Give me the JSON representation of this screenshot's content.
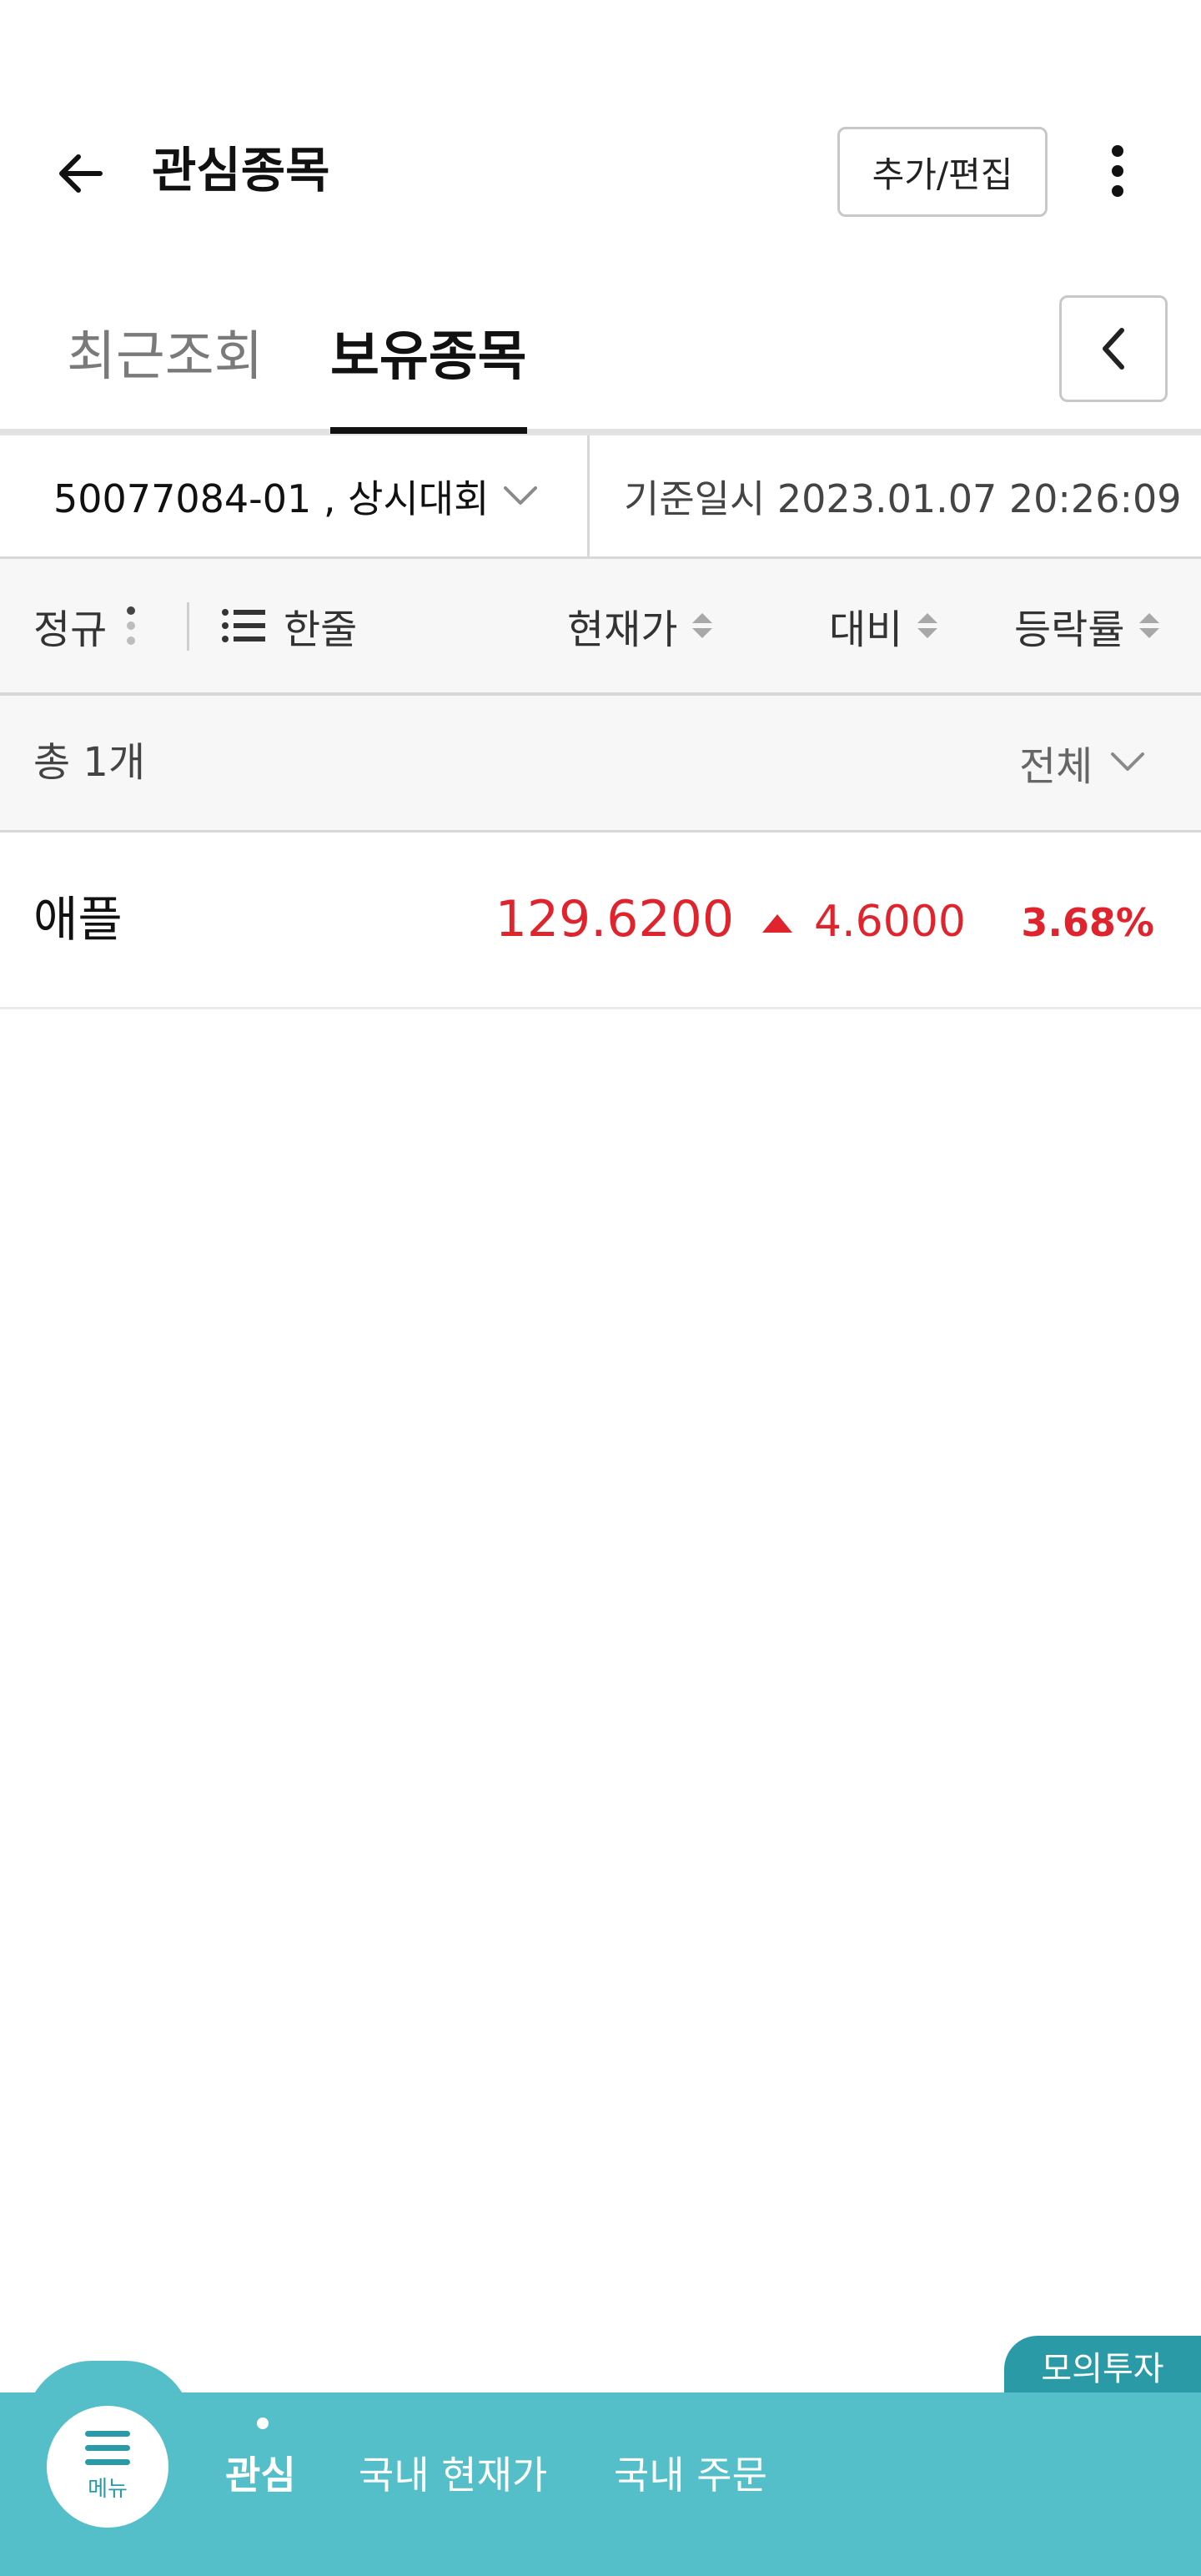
{
  "header": {
    "title": "관심종목",
    "add_edit_label": "추가/편집",
    "back_icon": "arrow-left-icon",
    "more_icon": "kebab-menu-icon"
  },
  "tabs": [
    {
      "label": "최근조회",
      "active": false
    },
    {
      "label": "보유종목",
      "active": true
    }
  ],
  "account": {
    "label": "50077084-01 , 상시대회",
    "base_time": "기준일시 2023.01.07 20:26:09"
  },
  "columns": {
    "session": "정규",
    "line_mode": "한줄",
    "price": "현재가",
    "change": "대비",
    "rate": "등락률"
  },
  "summary": {
    "total": "총 1개",
    "filter": "전체"
  },
  "stocks": [
    {
      "name": "애플",
      "price": "129.6200",
      "change": "4.6000",
      "rate": "3.68%",
      "direction": "up"
    }
  ],
  "badge": "모의투자",
  "bottom_nav": {
    "menu_label": "메뉴",
    "items": [
      "관심",
      "국내 현재가",
      "국내 주문"
    ]
  },
  "colors": {
    "up": "#e0242e",
    "accent": "#54bfc8",
    "accent_dark": "#2a9ba6"
  }
}
